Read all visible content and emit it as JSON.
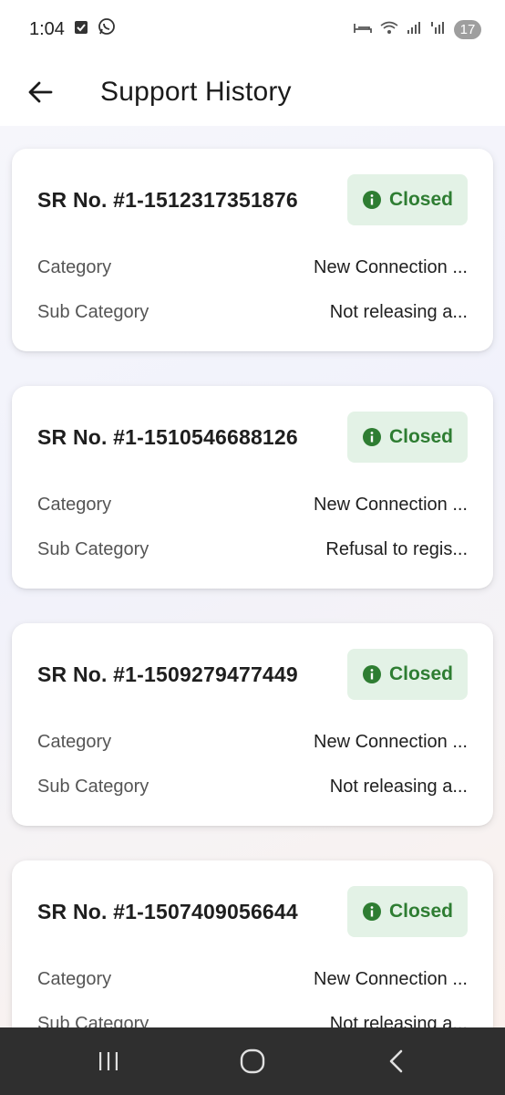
{
  "status_bar": {
    "time": "1:04",
    "battery": "17"
  },
  "header": {
    "title": "Support History"
  },
  "tickets": [
    {
      "sr": "SR No. #1-1512317351876",
      "status": "Closed",
      "category_label": "Category",
      "category": "New Connection ...",
      "sub_category_label": "Sub Category",
      "sub_category": "Not releasing a..."
    },
    {
      "sr": "SR No. #1-1510546688126",
      "status": "Closed",
      "category_label": "Category",
      "category": "New Connection ...",
      "sub_category_label": "Sub Category",
      "sub_category": "Refusal to regis..."
    },
    {
      "sr": "SR No. #1-1509279477449",
      "status": "Closed",
      "category_label": "Category",
      "category": "New Connection ...",
      "sub_category_label": "Sub Category",
      "sub_category": "Not releasing a..."
    },
    {
      "sr": "SR No. #1-1507409056644",
      "status": "Closed",
      "category_label": "Category",
      "category": "New Connection ...",
      "sub_category_label": "Sub Category",
      "sub_category": "Not releasing a..."
    }
  ],
  "colors": {
    "status_closed_bg": "#e3f2e6",
    "status_closed_text": "#2e7d32"
  },
  "icons": {
    "back": "arrow-left-icon",
    "status": "info-icon",
    "nav_recents": "recents-icon",
    "nav_home": "home-icon",
    "nav_back": "back-chevron-icon"
  }
}
